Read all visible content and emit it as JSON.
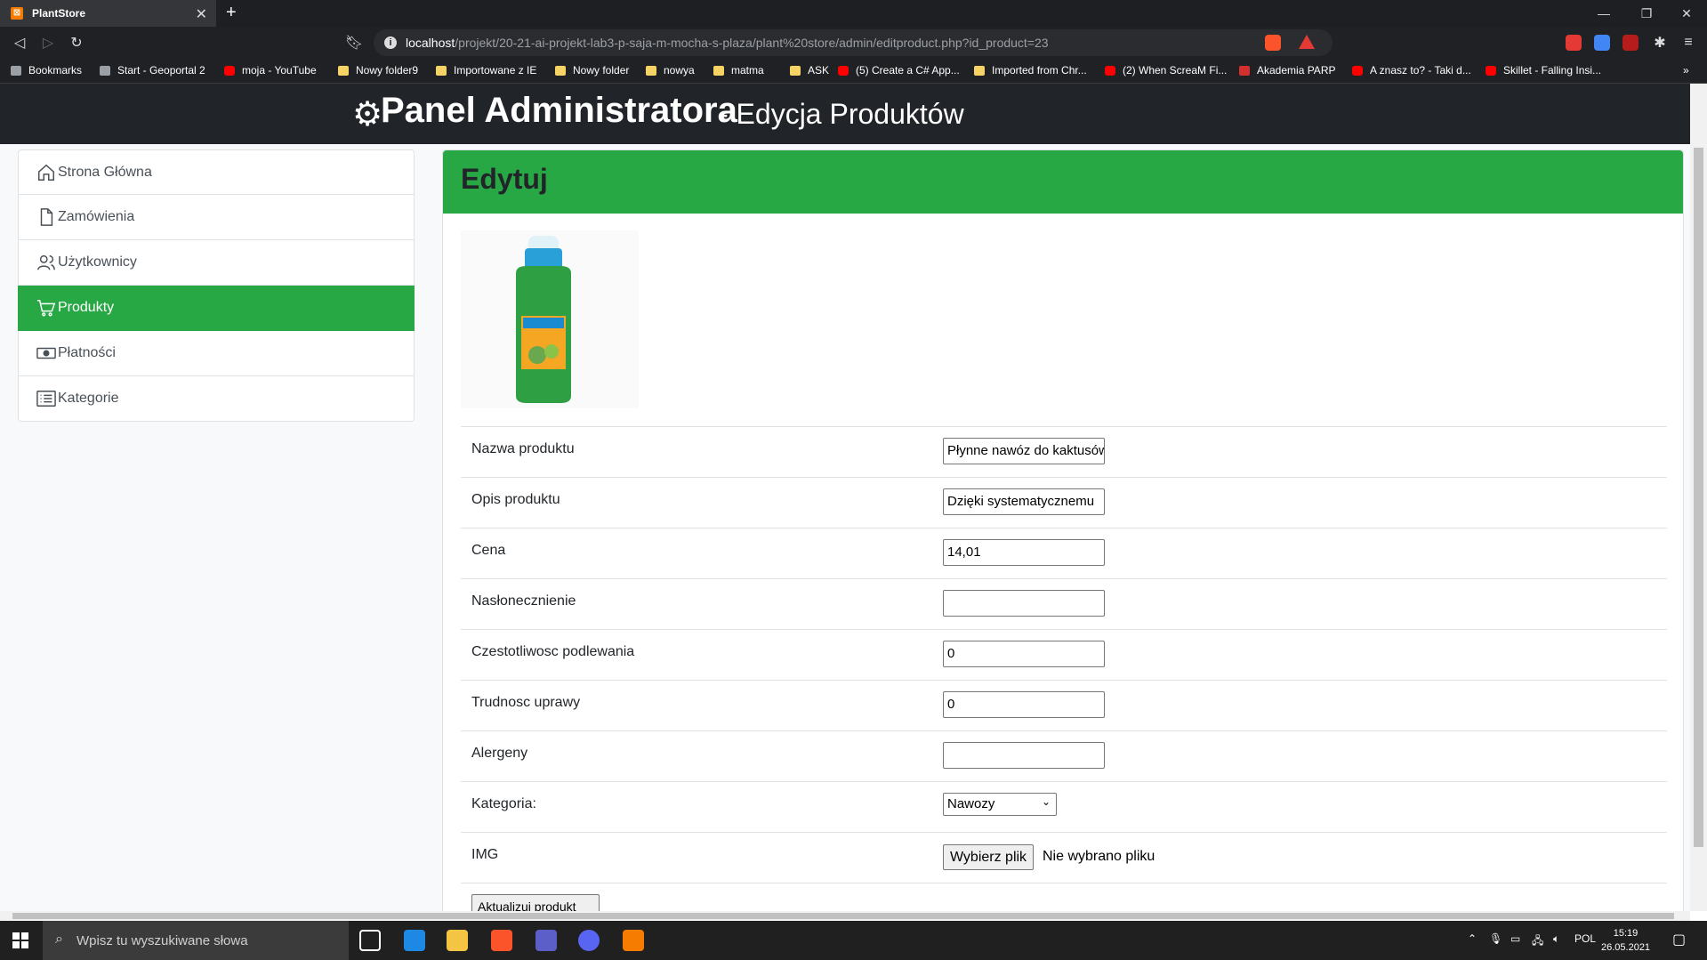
{
  "browser": {
    "tab_title": "PlantStore",
    "url_host": "localhost",
    "url_path": "/projekt/20-21-ai-projekt-lab3-p-saja-m-mocha-s-plaza/plant%20store/admin/editproduct.php?id_product=23",
    "bookmarks": [
      {
        "label": "Bookmarks",
        "icon": "bookmarks-icon"
      },
      {
        "label": "Start - Geoportal 2",
        "icon": "site-icon"
      },
      {
        "label": "moja - YouTube",
        "icon": "youtube-icon"
      },
      {
        "label": "Nowy folder9",
        "icon": "folder-icon"
      },
      {
        "label": "Importowane z IE",
        "icon": "folder-icon"
      },
      {
        "label": "Nowy folder",
        "icon": "folder-icon"
      },
      {
        "label": "nowya",
        "icon": "folder-icon"
      },
      {
        "label": "matma",
        "icon": "folder-icon"
      },
      {
        "label": "ASK",
        "icon": "folder-icon"
      },
      {
        "label": "(5) Create a C# App...",
        "icon": "youtube-icon"
      },
      {
        "label": "Imported from Chr...",
        "icon": "folder-icon"
      },
      {
        "label": "(2) When ScreaM Fi...",
        "icon": "youtube-icon"
      },
      {
        "label": "Akademia PARP",
        "icon": "pdf-icon"
      },
      {
        "label": "A znasz to? - Taki d...",
        "icon": "youtube-icon"
      },
      {
        "label": "Skillet - Falling Insi...",
        "icon": "youtube-icon"
      }
    ]
  },
  "header": {
    "title": "Panel Administratora",
    "subtitle": "- Edycja Produktów"
  },
  "sidebar": {
    "items": [
      {
        "label": "Strona Główna",
        "icon": "home-icon",
        "active": false
      },
      {
        "label": "Zamówienia",
        "icon": "file-icon",
        "active": false
      },
      {
        "label": "Użytkownicy",
        "icon": "users-icon",
        "active": false
      },
      {
        "label": "Produkty",
        "icon": "cart-icon",
        "active": true
      },
      {
        "label": "Płatności",
        "icon": "cash-icon",
        "active": false
      },
      {
        "label": "Kategorie",
        "icon": "list-icon",
        "active": false
      }
    ]
  },
  "edit": {
    "title": "Edytuj",
    "fields": {
      "name": {
        "label": "Nazwa produktu",
        "value": "Płynne nawóz do kaktusów"
      },
      "description": {
        "label": "Opis produktu",
        "value": "Dzięki systematycznemu"
      },
      "price": {
        "label": "Cena",
        "value": "14,01"
      },
      "sunlight": {
        "label": "Nasłonecznienie",
        "value": ""
      },
      "watering": {
        "label": "Czestotliwosc podlewania",
        "value": "0"
      },
      "difficulty": {
        "label": "Trudnosc uprawy",
        "value": "0"
      },
      "allergens": {
        "label": "Alergeny",
        "value": ""
      },
      "category": {
        "label": "Kategoria:",
        "value": "Nawozy"
      },
      "img": {
        "label": "IMG",
        "button": "Wybierz plik",
        "status": "Nie wybrano pliku"
      }
    },
    "submit_label": "Aktualizuj produkt"
  },
  "taskbar": {
    "search_placeholder": "Wpisz tu wyszukiwane słowa",
    "lang": "POL",
    "time": "15:19",
    "date": "26.05.2021"
  },
  "colors": {
    "accent": "#28a745",
    "header_bg": "#212529"
  }
}
